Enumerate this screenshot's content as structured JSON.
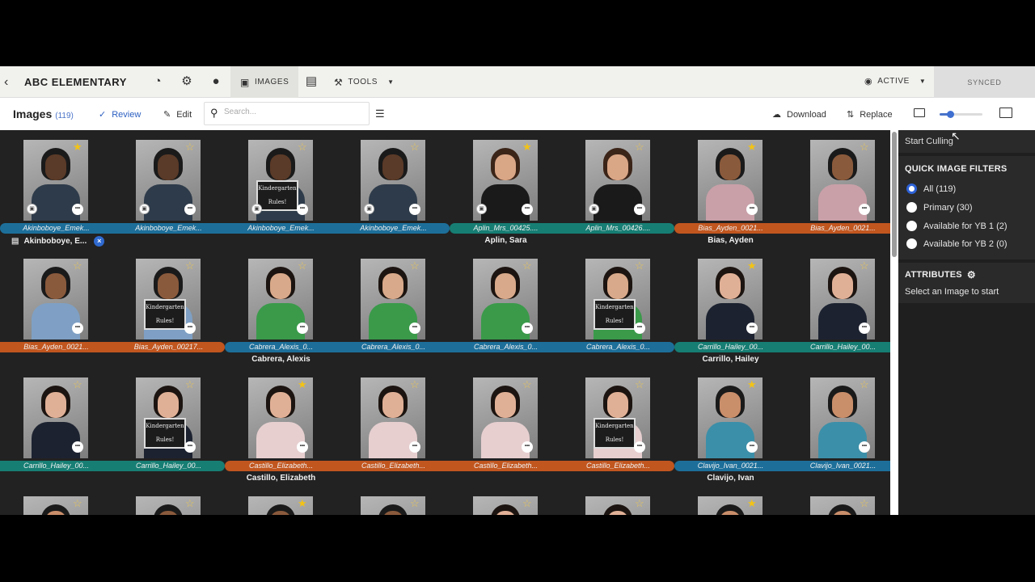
{
  "nav": {
    "title": "ABC ELEMENTARY",
    "tabs": {
      "images": "IMAGES",
      "tools": "TOOLS"
    },
    "status": "ACTIVE",
    "synced": "SYNCED"
  },
  "toolbar": {
    "title": "Images",
    "count": "(119)",
    "review": "Review",
    "edit": "Edit",
    "search_placeholder": "Search...",
    "download": "Download",
    "replace": "Replace",
    "zoom_level": 0.25
  },
  "colors": {
    "blue": "#1d6f9a",
    "orange": "#c1561f",
    "teal": "#177e74",
    "accent": "#2d62d6",
    "star": "#f2c316"
  },
  "grid": {
    "rows": [
      {
        "cells": [
          {
            "label": "Akinboboye_Emek...",
            "color": "blue",
            "pos": "first",
            "star": "filled",
            "badge": true,
            "skin": "#5a3a28",
            "hair": "#1a1a1a",
            "shirt": "#2e3b4a"
          },
          {
            "label": "Akinboboye_Emek...",
            "color": "blue",
            "pos": "mid",
            "star": "empty",
            "badge": true,
            "skin": "#5a3a28",
            "hair": "#1a1a1a",
            "shirt": "#2e3b4a"
          },
          {
            "label": "Akinboboye_Emek...",
            "color": "blue",
            "pos": "mid",
            "star": "empty",
            "badge": true,
            "sign": true,
            "skin": "#5a3a28",
            "hair": "#1a1a1a",
            "shirt": "#2e3b4a"
          },
          {
            "label": "Akinboboye_Emek...",
            "color": "blue",
            "pos": "last",
            "star": "empty",
            "badge": true,
            "skin": "#5a3a28",
            "hair": "#1a1a1a",
            "shirt": "#2e3b4a"
          },
          {
            "label": "Aplin_Mrs_00425....",
            "color": "teal",
            "pos": "first",
            "star": "filled",
            "badge": true,
            "skin": "#d9a686",
            "hair": "#3b2418",
            "shirt": "#1a1a1a"
          },
          {
            "label": "Aplin_Mrs_00426....",
            "color": "teal",
            "pos": "last",
            "star": "empty",
            "badge": true,
            "skin": "#d9a686",
            "hair": "#3b2418",
            "shirt": "#1a1a1a"
          },
          {
            "label": "Bias_Ayden_0021...",
            "color": "orange",
            "pos": "first",
            "star": "filled",
            "badge": false,
            "skin": "#8a5a3c",
            "hair": "#1a1a1a",
            "shirt": "#c9a0a8"
          },
          {
            "label": "Bias_Ayden_0021...",
            "color": "orange",
            "pos": "mid",
            "star": "empty",
            "badge": false,
            "skin": "#8a5a3c",
            "hair": "#1a1a1a",
            "shirt": "#c9a0a8"
          }
        ],
        "groups": [
          {
            "name": "Aplin, Sara",
            "col": 4.5
          },
          {
            "name": "Bias, Ayden",
            "col": 6.5
          }
        ],
        "selected_group": "Akinboboye, E..."
      },
      {
        "cells": [
          {
            "label": "Bias_Ayden_0021...",
            "color": "orange",
            "pos": "mid",
            "star": "empty",
            "skin": "#8a5a3c",
            "hair": "#1a1a1a",
            "shirt": "#7fa0c4"
          },
          {
            "label": "Bias_Ayden_00217...",
            "color": "orange",
            "pos": "last",
            "star": "empty",
            "sign": true,
            "skin": "#8a5a3c",
            "hair": "#1a1a1a",
            "shirt": "#7fa0c4"
          },
          {
            "label": "Cabrera_Alexis_0...",
            "color": "blue",
            "pos": "first",
            "star": "empty",
            "skin": "#d8a98a",
            "hair": "#1c1410",
            "shirt": "#3a9a4a"
          },
          {
            "label": "Cabrera_Alexis_0...",
            "color": "blue",
            "pos": "mid",
            "star": "empty",
            "skin": "#d8a98a",
            "hair": "#1c1410",
            "shirt": "#3a9a4a"
          },
          {
            "label": "Cabrera_Alexis_0...",
            "color": "blue",
            "pos": "mid",
            "star": "empty",
            "skin": "#d8a98a",
            "hair": "#1c1410",
            "shirt": "#3a9a4a"
          },
          {
            "label": "Cabrera_Alexis_0...",
            "color": "blue",
            "pos": "last",
            "star": "empty",
            "sign": true,
            "skin": "#d8a98a",
            "hair": "#1c1410",
            "shirt": "#3a9a4a"
          },
          {
            "label": "Carrillo_Hailey_00...",
            "color": "teal",
            "pos": "first",
            "star": "filled",
            "skin": "#e0b096",
            "hair": "#1c1410",
            "shirt": "#1c2230"
          },
          {
            "label": "Carrillo_Hailey_00...",
            "color": "teal",
            "pos": "mid",
            "star": "empty",
            "skin": "#e0b096",
            "hair": "#1c1410",
            "shirt": "#1c2230"
          }
        ],
        "groups": [
          {
            "name": "Cabrera, Alexis",
            "col": 2.5
          },
          {
            "name": "Carrillo, Hailey",
            "col": 6.5
          }
        ]
      },
      {
        "cells": [
          {
            "label": "Carrillo_Hailey_00...",
            "color": "teal",
            "pos": "mid",
            "star": "empty",
            "skin": "#e0b096",
            "hair": "#1c1410",
            "shirt": "#1c2230"
          },
          {
            "label": "Carrillo_Hailey_00...",
            "color": "teal",
            "pos": "last",
            "star": "empty",
            "sign": true,
            "skin": "#e0b096",
            "hair": "#1c1410",
            "shirt": "#1c2230"
          },
          {
            "label": "Castillo_Elizabeth...",
            "color": "orange",
            "pos": "first",
            "star": "filled",
            "skin": "#e0b096",
            "hair": "#1c1410",
            "shirt": "#e7cfd0"
          },
          {
            "label": "Castillo_Elizabeth...",
            "color": "orange",
            "pos": "mid",
            "star": "empty",
            "skin": "#e0b096",
            "hair": "#1c1410",
            "shirt": "#e7cfd0"
          },
          {
            "label": "Castillo_Elizabeth...",
            "color": "orange",
            "pos": "mid",
            "star": "empty",
            "skin": "#e0b096",
            "hair": "#1c1410",
            "shirt": "#e7cfd0"
          },
          {
            "label": "Castillo_Elizabeth...",
            "color": "orange",
            "pos": "last",
            "star": "empty",
            "sign": true,
            "skin": "#e0b096",
            "hair": "#1c1410",
            "shirt": "#e7cfd0"
          },
          {
            "label": "Clavijo_Ivan_0021...",
            "color": "blue",
            "pos": "first",
            "star": "filled",
            "skin": "#c98e6a",
            "hair": "#1a1a1a",
            "shirt": "#3c8fa8"
          },
          {
            "label": "Clavijo_Ivan_0021...",
            "color": "blue",
            "pos": "mid",
            "star": "empty",
            "skin": "#c98e6a",
            "hair": "#1a1a1a",
            "shirt": "#3c8fa8"
          }
        ],
        "groups": [
          {
            "name": "Castillo, Elizabeth",
            "col": 2.5
          },
          {
            "name": "Clavijo, Ivan",
            "col": 6.5
          }
        ]
      },
      {
        "cells": [
          {
            "label": "",
            "star": "empty",
            "skin": "#c98e6a",
            "hair": "#1a1a1a",
            "shirt": "#3c8fa8"
          },
          {
            "label": "",
            "star": "empty",
            "skin": "#8a5a3c",
            "hair": "#1a1a1a",
            "shirt": "#3c3c3c"
          },
          {
            "label": "",
            "star": "filled",
            "skin": "#8a5a3c",
            "hair": "#1a1a1a",
            "shirt": "#3c3c3c"
          },
          {
            "label": "",
            "star": "empty",
            "skin": "#8a5a3c",
            "hair": "#1a1a1a",
            "shirt": "#3c3c3c"
          },
          {
            "label": "",
            "star": "empty",
            "skin": "#e0b096",
            "hair": "#1c1410",
            "shirt": "#3c3c3c"
          },
          {
            "label": "",
            "star": "empty",
            "skin": "#e0b096",
            "hair": "#1c1410",
            "shirt": "#3c3c3c"
          },
          {
            "label": "",
            "star": "filled",
            "skin": "#c98e6a",
            "hair": "#1a1a1a",
            "shirt": "#3c3c3c"
          },
          {
            "label": "",
            "star": "empty",
            "skin": "#c98e6a",
            "hair": "#1a1a1a",
            "shirt": "#3c3c3c"
          }
        ],
        "groups": []
      }
    ],
    "sign_text": [
      "Kindergarten",
      "Rules!"
    ]
  },
  "panel": {
    "start_culling": "Start Culling",
    "filters_title": "QUICK IMAGE FILTERS",
    "filters": [
      {
        "label": "All (119)",
        "selected": true
      },
      {
        "label": "Primary (30)",
        "selected": false
      },
      {
        "label": "Available for YB 1 (2)",
        "selected": false
      },
      {
        "label": "Available for YB 2 (0)",
        "selected": false
      }
    ],
    "attributes_title": "ATTRIBUTES",
    "attributes_hint": "Select an Image to start"
  }
}
